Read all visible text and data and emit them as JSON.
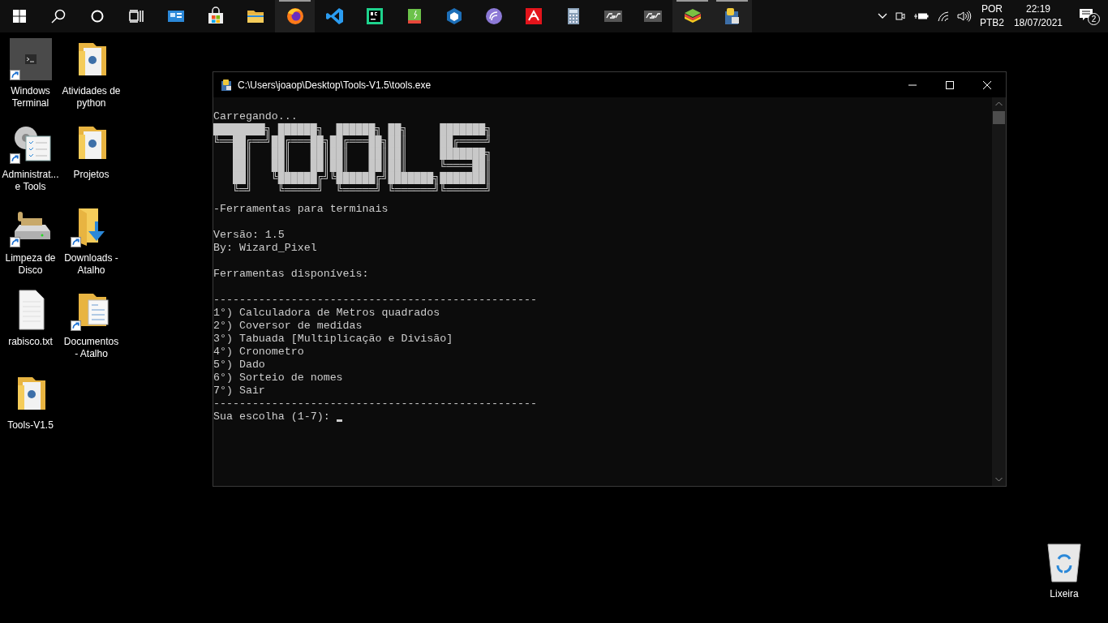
{
  "taskbar": {
    "apps": [
      {
        "running": false
      },
      {
        "running": false
      },
      {
        "running": false
      },
      {
        "running": true
      },
      {
        "running": false
      },
      {
        "running": false
      },
      {
        "running": false
      },
      {
        "running": false
      },
      {
        "running": false
      },
      {
        "running": false
      },
      {
        "running": false
      },
      {
        "running": false
      },
      {
        "running": false
      },
      {
        "running": true
      },
      {
        "running": true
      }
    ],
    "tray": {
      "language": "POR",
      "layout": "PTB2",
      "time": "22:19",
      "date": "18/07/2021",
      "notifications": "2"
    }
  },
  "desktop_icons": [
    {
      "label": "Windows Terminal",
      "kind": "terminal",
      "shortcut": true
    },
    {
      "label": "Atividades de python",
      "kind": "folder",
      "shortcut": false
    },
    {
      "label": "Administrat... e Tools",
      "kind": "admin",
      "shortcut": true
    },
    {
      "label": "Projetos",
      "kind": "folder",
      "shortcut": false
    },
    {
      "label": "Limpeza de Disco",
      "kind": "cleanup",
      "shortcut": true
    },
    {
      "label": "Downloads - Atalho",
      "kind": "downloads",
      "shortcut": true
    },
    {
      "label": "rabisco.txt",
      "kind": "textfile",
      "shortcut": false
    },
    {
      "label": "Documentos - Atalho",
      "kind": "documents",
      "shortcut": true
    },
    {
      "label": "Tools-V1.5",
      "kind": "folder",
      "shortcut": false
    }
  ],
  "recycle_bin": {
    "label": "Lixeira"
  },
  "window": {
    "title": "C:\\Users\\joaop\\Desktop\\Tools-V1.5\\tools.exe",
    "console": {
      "loading": "Carregando...",
      "banner": [
        "████████╗ ██████╗  ██████╗ ██╗     ███████╗",
        "╚══██╔══╝██╔═══██╗██╔═══██╗██║     ██╔════╝",
        "   ██║   ██║   ██║██║   ██║██║     ███████╗",
        "   ██║   ██║   ██║██║   ██║██║     ╚════██║",
        "   ██║   ╚██████╔╝╚██████╔╝███████╗███████║",
        "   ╚═╝    ╚═════╝  ╚═════╝ ╚══════╝╚══════╝"
      ],
      "subtitle": "-Ferramentas para terminais",
      "version": "Versão: 1.5",
      "author": "By: Wizard_Pixel",
      "tools_heading": "Ferramentas disponíveis:",
      "separator_top": "--------------------------------------------------",
      "menu_items": [
        "1°) Calculadora de Metros quadrados",
        "2°) Coversor de medidas",
        "3°) Tabuada [Multiplicação e Divisão]",
        "4°) Cronometro",
        "5°) Dado",
        "6°) Sorteio de nomes",
        "7°) Sair"
      ],
      "separator_bottom": "--------------------------------------------------",
      "prompt": "Sua escolha (1-7): "
    }
  }
}
